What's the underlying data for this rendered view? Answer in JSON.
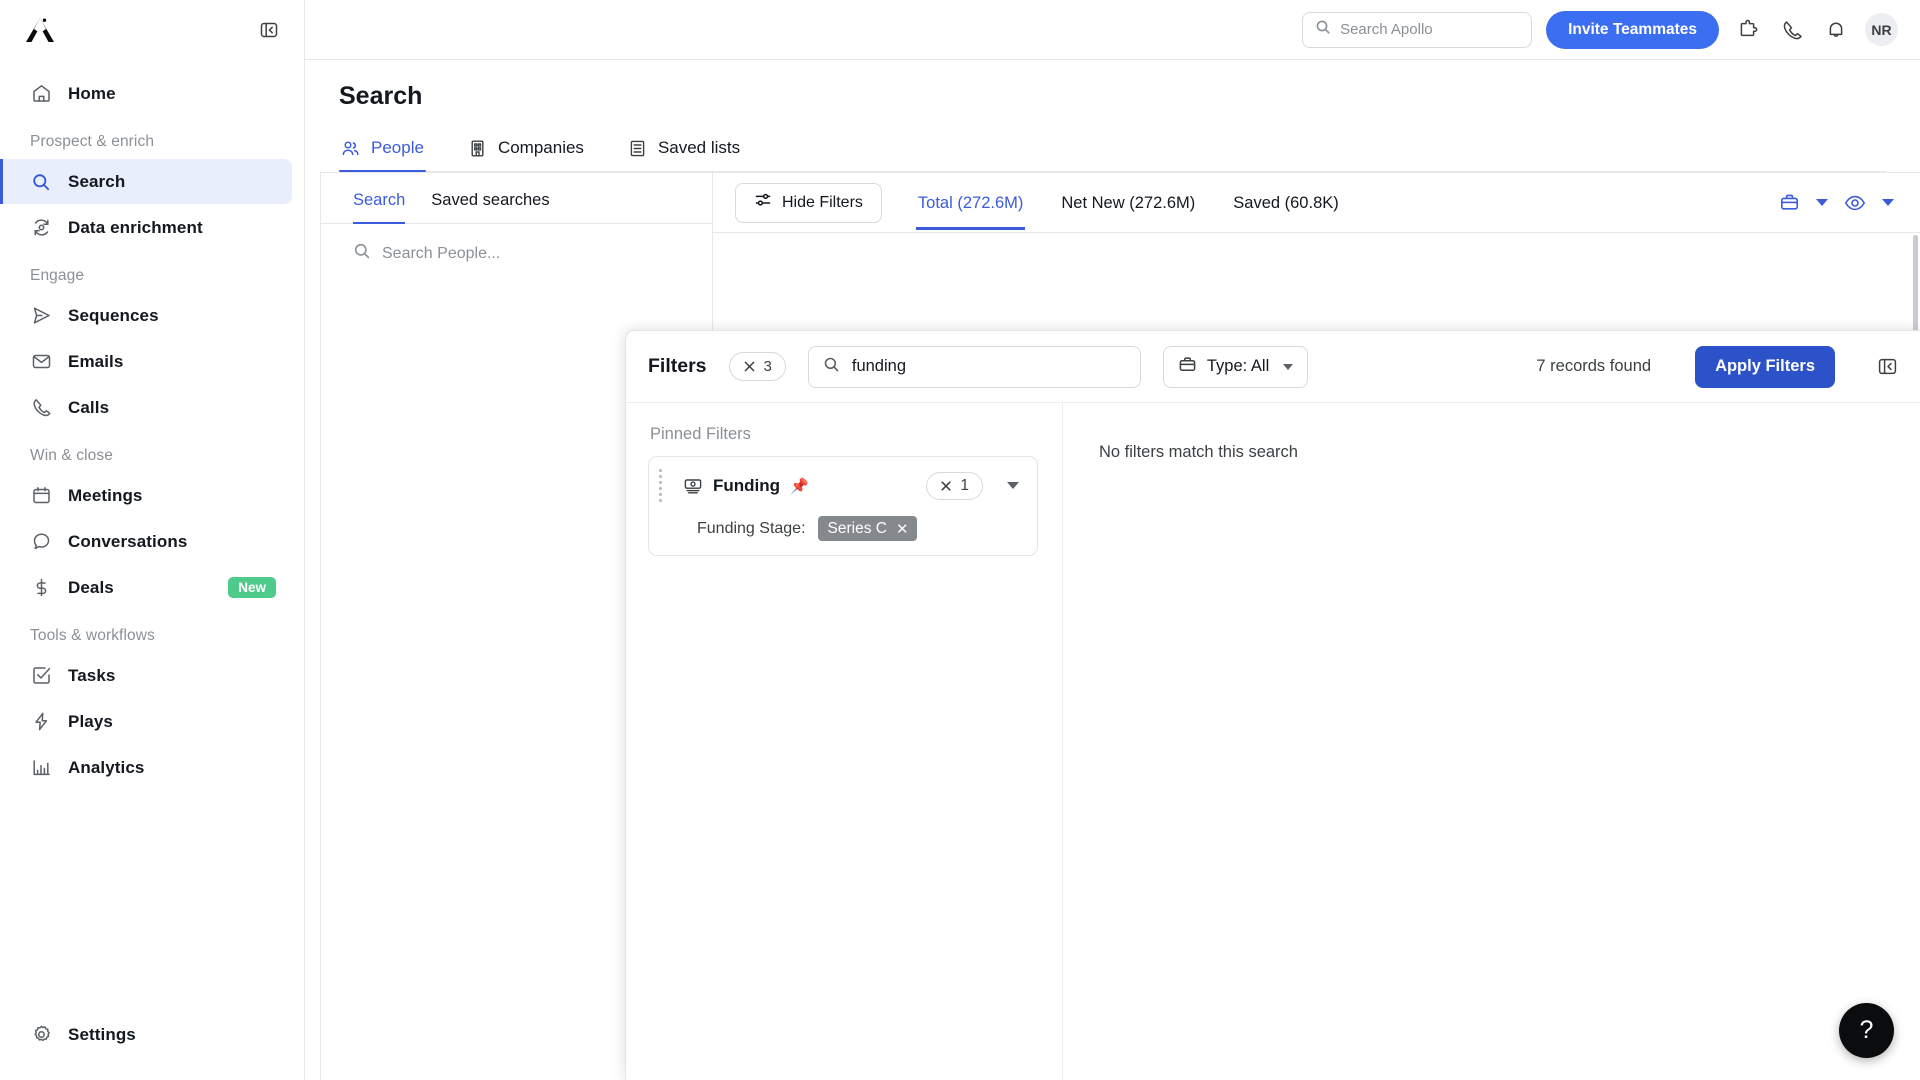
{
  "app": {
    "logo_name": "apollo-logo",
    "collapse_icon": "panel-collapse-icon"
  },
  "sidebar": {
    "groups": [
      {
        "label": "",
        "items": [
          {
            "label": "Home",
            "icon": "home-icon",
            "active": false
          }
        ]
      },
      {
        "label": "Prospect & enrich",
        "items": [
          {
            "label": "Search",
            "icon": "search-icon",
            "active": true
          },
          {
            "label": "Data enrichment",
            "icon": "refresh-data-icon",
            "active": false
          }
        ]
      },
      {
        "label": "Engage",
        "items": [
          {
            "label": "Sequences",
            "icon": "send-icon",
            "active": false
          },
          {
            "label": "Emails",
            "icon": "envelope-icon",
            "active": false
          },
          {
            "label": "Calls",
            "icon": "phone-icon",
            "active": false
          }
        ]
      },
      {
        "label": "Win & close",
        "items": [
          {
            "label": "Meetings",
            "icon": "calendar-icon",
            "active": false
          },
          {
            "label": "Conversations",
            "icon": "chat-bubble-icon",
            "active": false
          },
          {
            "label": "Deals",
            "icon": "dollar-icon",
            "active": false,
            "badge": "New"
          }
        ]
      },
      {
        "label": "Tools & workflows",
        "items": [
          {
            "label": "Tasks",
            "icon": "checkbox-icon",
            "active": false
          },
          {
            "label": "Plays",
            "icon": "lightning-icon",
            "active": false
          },
          {
            "label": "Analytics",
            "icon": "bar-chart-icon",
            "active": false
          }
        ]
      }
    ],
    "settings": {
      "label": "Settings",
      "icon": "gear-icon"
    }
  },
  "topbar": {
    "search_placeholder": "Search Apollo",
    "search_icon": "search-icon",
    "invite_label": "Invite Teammates",
    "icons": [
      "puzzle-icon",
      "phone-icon",
      "bell-icon"
    ],
    "avatar_initials": "NR"
  },
  "page": {
    "title": "Search",
    "tabs": [
      {
        "label": "People",
        "icon": "people-icon",
        "active": true
      },
      {
        "label": "Companies",
        "icon": "building-icon",
        "active": false
      },
      {
        "label": "Saved lists",
        "icon": "list-icon",
        "active": false
      }
    ]
  },
  "filter_rail": {
    "tabs": [
      {
        "label": "Search",
        "active": true
      },
      {
        "label": "Saved searches",
        "active": false
      }
    ],
    "search_placeholder": "Search People...",
    "search_icon": "search-icon"
  },
  "results_toolbar": {
    "hide_filters_label": "Hide Filters",
    "hide_filters_icon": "sliders-icon",
    "count_tabs": [
      {
        "label": "Total (272.6M)",
        "active": true
      },
      {
        "label": "Net New (272.6M)",
        "active": false
      },
      {
        "label": "Saved (60.8K)",
        "active": false
      }
    ],
    "right_icons": [
      {
        "name": "briefcase-icon"
      },
      {
        "name": "chevron-down-icon"
      },
      {
        "name": "eye-icon"
      },
      {
        "name": "chevron-down-icon"
      }
    ]
  },
  "filter_modal": {
    "title": "Filters",
    "clear_count": "3",
    "clear_icon": "close-icon",
    "search_value": "funding",
    "search_icon": "search-icon",
    "type_select_label": "Type: All",
    "type_select_icon": "briefcase-icon",
    "records_found": "7 records found",
    "apply_label": "Apply Filters",
    "collapse_icon": "panel-collapse-icon",
    "pinned_label": "Pinned Filters",
    "pinned_filters": [
      {
        "name": "Funding",
        "icon": "banknote-icon",
        "pin_icon": "pin-icon",
        "count": "1",
        "count_clear_icon": "close-icon",
        "expand_icon": "chevron-down-icon",
        "sub_label": "Funding Stage:",
        "chips": [
          {
            "label": "Series C",
            "remove_icon": "close-icon"
          }
        ]
      }
    ],
    "empty_state": "No filters match this search"
  },
  "help": {
    "label": "?",
    "icon": "help-icon"
  },
  "colors": {
    "accent_blue": "#3b5bdb",
    "primary_button": "#3b6ef0",
    "apply_button": "#2c52c9",
    "badge_green": "#4ecb8a",
    "chip_gray": "#85888c",
    "active_nav_bg": "#e8eefc"
  }
}
